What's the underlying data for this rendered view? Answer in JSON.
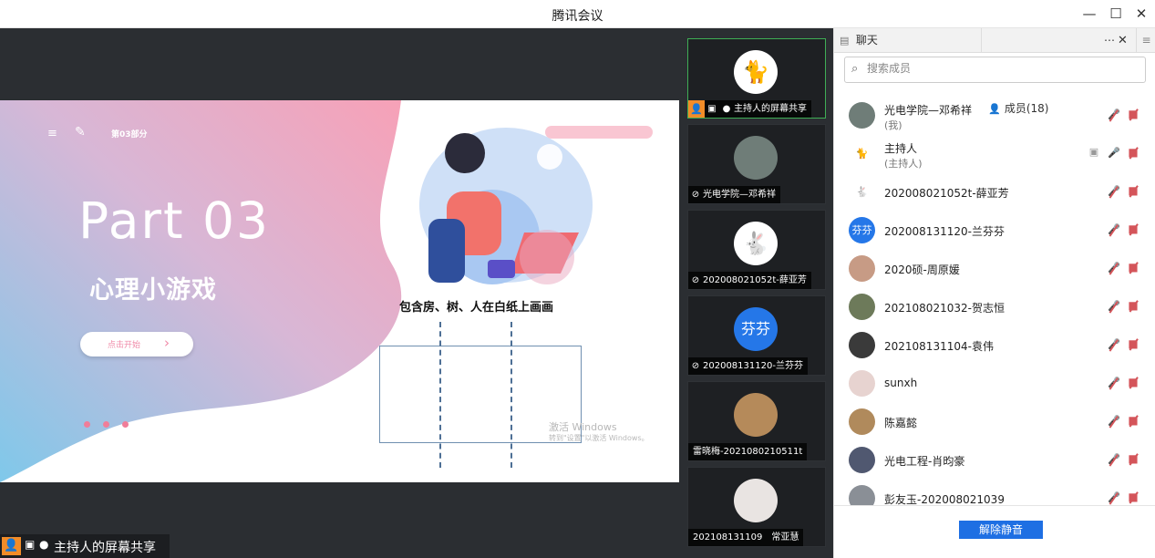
{
  "window": {
    "title": "腾讯会议",
    "minimize_icon": "minimize-icon",
    "maximize_icon": "maximize-icon",
    "close_icon": "close-icon"
  },
  "slide": {
    "tag": "第03部分",
    "part_title": "Part 03",
    "subtitle": "心理小游戏",
    "start_button": "点击开始",
    "caption": "包含房、树、人在白纸上画画",
    "watermark_line1": "激活 Windows",
    "watermark_line2": "转到\"设置\"以激活 Windows。",
    "colors": {
      "pink": "#f7a1b7",
      "blue": "#8ec9ea",
      "accent": "#f07d99"
    }
  },
  "share_tag": {
    "label": "主持人的屏幕共享"
  },
  "thumbnails": [
    {
      "label": "主持人的屏幕共享",
      "avatar": "cat-avatar",
      "glyph": "🐈",
      "active": true
    },
    {
      "label": "光电学院—邓希祥",
      "avatar": "photo-avatar",
      "glyph": "",
      "active": false
    },
    {
      "label": "202008021052t-薛亚芳",
      "avatar": "rabbit-avatar",
      "glyph": "🐇",
      "active": false
    },
    {
      "label": "202008131120-兰芬芬",
      "avatar": "text-avatar",
      "glyph": "芬芬",
      "active": false
    },
    {
      "label": "雷晓梅-2021080210511t",
      "avatar": "photo-avatar",
      "glyph": "",
      "active": false
    },
    {
      "label": "202108131109　常亚慧",
      "avatar": "figure-avatar",
      "glyph": "",
      "active": false
    }
  ],
  "panel": {
    "tab_chat": "聊天",
    "tab_members": "成员(18)",
    "search_placeholder": "搜索成员",
    "unmute_all": "解除静音",
    "members": [
      {
        "name": "光电学院—邓希祥",
        "role": "(我)",
        "avatar": "photo",
        "color": "#6f7d78",
        "mic_on": false,
        "screen": false
      },
      {
        "name": "主持人",
        "role": "(主持人)",
        "avatar": "cat",
        "color": "#ffffff",
        "mic_on": true,
        "screen": true
      },
      {
        "name": "202008021052t-薛亚芳",
        "role": "",
        "avatar": "rabbit",
        "color": "#ffffff",
        "mic_on": false,
        "screen": false
      },
      {
        "name": "202008131120-兰芬芬",
        "role": "",
        "avatar": "芬芬",
        "color": "#2577e8",
        "mic_on": false,
        "screen": false
      },
      {
        "name": "2020硕-周原媛",
        "role": "",
        "avatar": "photo",
        "color": "#c79b85",
        "mic_on": false,
        "screen": false
      },
      {
        "name": "202108021032-贺志恒",
        "role": "",
        "avatar": "photo",
        "color": "#6d7a5a",
        "mic_on": false,
        "screen": false
      },
      {
        "name": "202108131104-袁伟",
        "role": "",
        "avatar": "photo",
        "color": "#3a3a3a",
        "mic_on": false,
        "screen": false
      },
      {
        "name": "sunxh",
        "role": "",
        "avatar": "photo",
        "color": "#e7d3d0",
        "mic_on": false,
        "screen": false
      },
      {
        "name": "陈嘉懿",
        "role": "",
        "avatar": "photo",
        "color": "#b08a5c",
        "mic_on": false,
        "screen": false
      },
      {
        "name": "光电工程-肖昀豪",
        "role": "",
        "avatar": "photo",
        "color": "#505870",
        "mic_on": false,
        "screen": false
      },
      {
        "name": "彭友玉-202008021039",
        "role": "",
        "avatar": "photo",
        "color": "#8a8f96",
        "mic_on": false,
        "screen": false
      }
    ]
  }
}
